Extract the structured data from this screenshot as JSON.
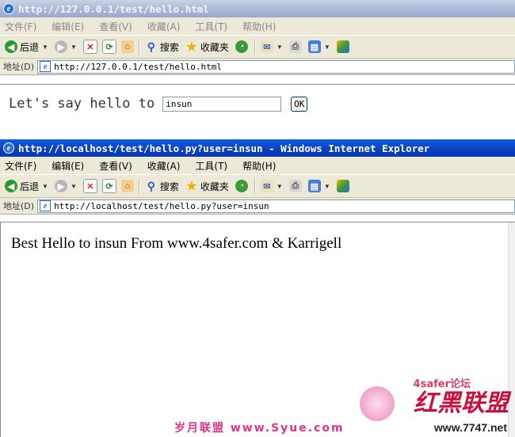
{
  "window1": {
    "title": "http://127.0.0.1/test/hello.html",
    "menu": [
      "文件(F)",
      "编辑(E)",
      "查看(V)",
      "收藏(A)",
      "工具(T)",
      "帮助(H)"
    ],
    "toolbar": {
      "back": "后退",
      "search": "搜索",
      "favorites": "收藏夹"
    },
    "address_label": "地址(D)",
    "address": "http://127.0.0.1/test/hello.html",
    "form": {
      "label": "Let's say hello to",
      "input_value": "insun",
      "ok": "OK"
    }
  },
  "window2": {
    "title": "http://localhost/test/hello.py?user=insun - Windows Internet Explorer",
    "menu": [
      "文件(F)",
      "编辑(E)",
      "查看(V)",
      "收藏(A)",
      "工具(T)",
      "帮助(H)"
    ],
    "toolbar": {
      "back": "后退",
      "search": "搜索",
      "favorites": "收藏夹"
    },
    "address_label": "地址(D)",
    "address": "http://localhost/test/hello.py?user=insun",
    "result": "Best Hello to insun From www.4safer.com & Karrigell"
  },
  "watermark": {
    "bottom_text": "岁月联盟  www.Syue.com",
    "logo_text": "红黑联盟",
    "logo_tag": "4safer论坛",
    "logo_url": "www.7747.net"
  },
  "colors": {
    "title_active": "#0a5fe0",
    "title_inactive": "#aab8d6",
    "chrome": "#ece9d8"
  }
}
